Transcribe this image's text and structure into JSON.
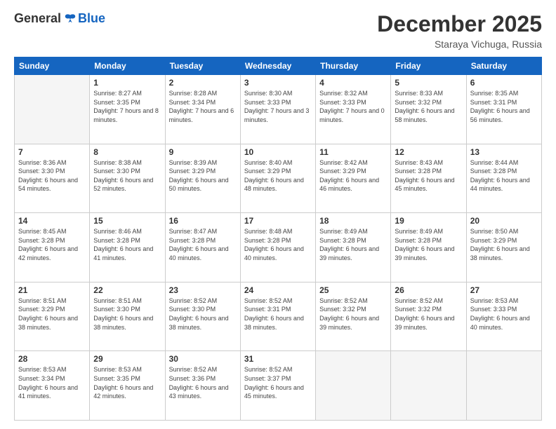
{
  "logo": {
    "general": "General",
    "blue": "Blue"
  },
  "header": {
    "month": "December 2025",
    "location": "Staraya Vichuga, Russia"
  },
  "weekdays": [
    "Sunday",
    "Monday",
    "Tuesday",
    "Wednesday",
    "Thursday",
    "Friday",
    "Saturday"
  ],
  "weeks": [
    [
      {
        "day": "",
        "sunrise": "",
        "sunset": "",
        "daylight": ""
      },
      {
        "day": "1",
        "sunrise": "Sunrise: 8:27 AM",
        "sunset": "Sunset: 3:35 PM",
        "daylight": "Daylight: 7 hours and 8 minutes."
      },
      {
        "day": "2",
        "sunrise": "Sunrise: 8:28 AM",
        "sunset": "Sunset: 3:34 PM",
        "daylight": "Daylight: 7 hours and 6 minutes."
      },
      {
        "day": "3",
        "sunrise": "Sunrise: 8:30 AM",
        "sunset": "Sunset: 3:33 PM",
        "daylight": "Daylight: 7 hours and 3 minutes."
      },
      {
        "day": "4",
        "sunrise": "Sunrise: 8:32 AM",
        "sunset": "Sunset: 3:33 PM",
        "daylight": "Daylight: 7 hours and 0 minutes."
      },
      {
        "day": "5",
        "sunrise": "Sunrise: 8:33 AM",
        "sunset": "Sunset: 3:32 PM",
        "daylight": "Daylight: 6 hours and 58 minutes."
      },
      {
        "day": "6",
        "sunrise": "Sunrise: 8:35 AM",
        "sunset": "Sunset: 3:31 PM",
        "daylight": "Daylight: 6 hours and 56 minutes."
      }
    ],
    [
      {
        "day": "7",
        "sunrise": "Sunrise: 8:36 AM",
        "sunset": "Sunset: 3:30 PM",
        "daylight": "Daylight: 6 hours and 54 minutes."
      },
      {
        "day": "8",
        "sunrise": "Sunrise: 8:38 AM",
        "sunset": "Sunset: 3:30 PM",
        "daylight": "Daylight: 6 hours and 52 minutes."
      },
      {
        "day": "9",
        "sunrise": "Sunrise: 8:39 AM",
        "sunset": "Sunset: 3:29 PM",
        "daylight": "Daylight: 6 hours and 50 minutes."
      },
      {
        "day": "10",
        "sunrise": "Sunrise: 8:40 AM",
        "sunset": "Sunset: 3:29 PM",
        "daylight": "Daylight: 6 hours and 48 minutes."
      },
      {
        "day": "11",
        "sunrise": "Sunrise: 8:42 AM",
        "sunset": "Sunset: 3:29 PM",
        "daylight": "Daylight: 6 hours and 46 minutes."
      },
      {
        "day": "12",
        "sunrise": "Sunrise: 8:43 AM",
        "sunset": "Sunset: 3:28 PM",
        "daylight": "Daylight: 6 hours and 45 minutes."
      },
      {
        "day": "13",
        "sunrise": "Sunrise: 8:44 AM",
        "sunset": "Sunset: 3:28 PM",
        "daylight": "Daylight: 6 hours and 44 minutes."
      }
    ],
    [
      {
        "day": "14",
        "sunrise": "Sunrise: 8:45 AM",
        "sunset": "Sunset: 3:28 PM",
        "daylight": "Daylight: 6 hours and 42 minutes."
      },
      {
        "day": "15",
        "sunrise": "Sunrise: 8:46 AM",
        "sunset": "Sunset: 3:28 PM",
        "daylight": "Daylight: 6 hours and 41 minutes."
      },
      {
        "day": "16",
        "sunrise": "Sunrise: 8:47 AM",
        "sunset": "Sunset: 3:28 PM",
        "daylight": "Daylight: 6 hours and 40 minutes."
      },
      {
        "day": "17",
        "sunrise": "Sunrise: 8:48 AM",
        "sunset": "Sunset: 3:28 PM",
        "daylight": "Daylight: 6 hours and 40 minutes."
      },
      {
        "day": "18",
        "sunrise": "Sunrise: 8:49 AM",
        "sunset": "Sunset: 3:28 PM",
        "daylight": "Daylight: 6 hours and 39 minutes."
      },
      {
        "day": "19",
        "sunrise": "Sunrise: 8:49 AM",
        "sunset": "Sunset: 3:28 PM",
        "daylight": "Daylight: 6 hours and 39 minutes."
      },
      {
        "day": "20",
        "sunrise": "Sunrise: 8:50 AM",
        "sunset": "Sunset: 3:29 PM",
        "daylight": "Daylight: 6 hours and 38 minutes."
      }
    ],
    [
      {
        "day": "21",
        "sunrise": "Sunrise: 8:51 AM",
        "sunset": "Sunset: 3:29 PM",
        "daylight": "Daylight: 6 hours and 38 minutes."
      },
      {
        "day": "22",
        "sunrise": "Sunrise: 8:51 AM",
        "sunset": "Sunset: 3:30 PM",
        "daylight": "Daylight: 6 hours and 38 minutes."
      },
      {
        "day": "23",
        "sunrise": "Sunrise: 8:52 AM",
        "sunset": "Sunset: 3:30 PM",
        "daylight": "Daylight: 6 hours and 38 minutes."
      },
      {
        "day": "24",
        "sunrise": "Sunrise: 8:52 AM",
        "sunset": "Sunset: 3:31 PM",
        "daylight": "Daylight: 6 hours and 38 minutes."
      },
      {
        "day": "25",
        "sunrise": "Sunrise: 8:52 AM",
        "sunset": "Sunset: 3:32 PM",
        "daylight": "Daylight: 6 hours and 39 minutes."
      },
      {
        "day": "26",
        "sunrise": "Sunrise: 8:52 AM",
        "sunset": "Sunset: 3:32 PM",
        "daylight": "Daylight: 6 hours and 39 minutes."
      },
      {
        "day": "27",
        "sunrise": "Sunrise: 8:53 AM",
        "sunset": "Sunset: 3:33 PM",
        "daylight": "Daylight: 6 hours and 40 minutes."
      }
    ],
    [
      {
        "day": "28",
        "sunrise": "Sunrise: 8:53 AM",
        "sunset": "Sunset: 3:34 PM",
        "daylight": "Daylight: 6 hours and 41 minutes."
      },
      {
        "day": "29",
        "sunrise": "Sunrise: 8:53 AM",
        "sunset": "Sunset: 3:35 PM",
        "daylight": "Daylight: 6 hours and 42 minutes."
      },
      {
        "day": "30",
        "sunrise": "Sunrise: 8:52 AM",
        "sunset": "Sunset: 3:36 PM",
        "daylight": "Daylight: 6 hours and 43 minutes."
      },
      {
        "day": "31",
        "sunrise": "Sunrise: 8:52 AM",
        "sunset": "Sunset: 3:37 PM",
        "daylight": "Daylight: 6 hours and 45 minutes."
      },
      {
        "day": "",
        "sunrise": "",
        "sunset": "",
        "daylight": ""
      },
      {
        "day": "",
        "sunrise": "",
        "sunset": "",
        "daylight": ""
      },
      {
        "day": "",
        "sunrise": "",
        "sunset": "",
        "daylight": ""
      }
    ]
  ]
}
